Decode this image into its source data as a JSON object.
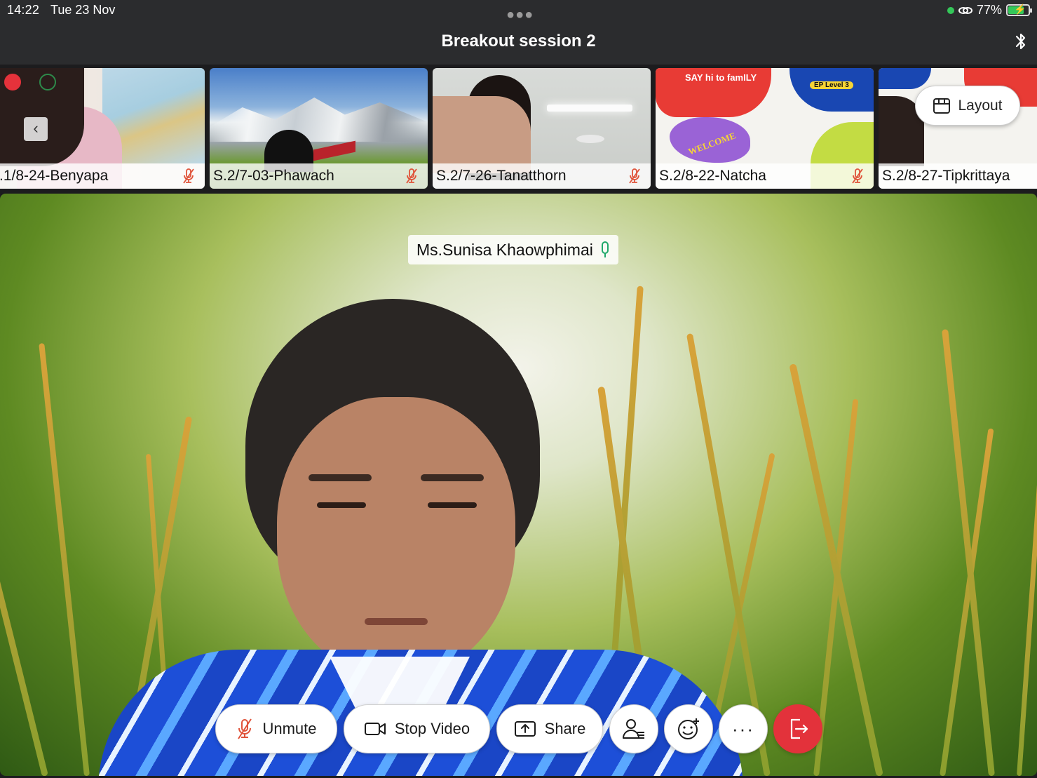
{
  "status_bar": {
    "time": "14:22",
    "date": "Tue 23 Nov",
    "battery": "77%",
    "battery_level": 0.77
  },
  "header": {
    "title": "Breakout session 2"
  },
  "participants_strip": [
    {
      "name": ".1/8-24-Benyapa",
      "muted": true
    },
    {
      "name": "S.2/7-03-Phawach",
      "muted": true
    },
    {
      "name": "S.2/7-26-Tanatthorn",
      "muted": true
    },
    {
      "name": "S.2/8-22-Natcha",
      "muted": true
    },
    {
      "name": "S.2/8-27-Tipkrittaya",
      "muted": false
    }
  ],
  "tile_art": {
    "natcha_banner": "SAY hi to famILY",
    "natcha_level": "EP Level 3",
    "natcha_welcome": "WELCOME"
  },
  "layout_button": {
    "label": "Layout"
  },
  "active_speaker": {
    "name": "Ms.Sunisa Khaowphimai"
  },
  "controls": {
    "unmute_label": "Unmute",
    "stop_video_label": "Stop Video",
    "share_label": "Share",
    "more_label": "···"
  },
  "colors": {
    "topbar": "#2b2c2e",
    "muted_mic": "#e0533a",
    "active_mic": "#1fa86a",
    "leave": "#e3323b"
  }
}
